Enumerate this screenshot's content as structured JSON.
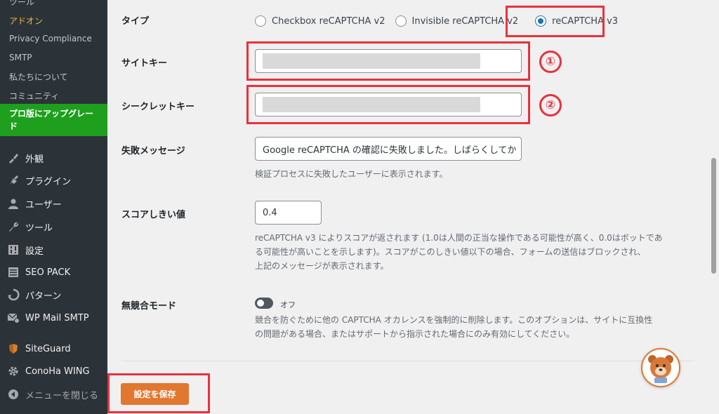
{
  "sidebar": {
    "submenu": [
      {
        "label": "ツール",
        "active": false
      },
      {
        "label": "アドオン",
        "active": true
      },
      {
        "label": "Privacy Compliance",
        "active": false
      },
      {
        "label": "SMTP",
        "active": false
      },
      {
        "label": "私たちについて",
        "active": false
      },
      {
        "label": "コミュニティ",
        "active": false
      }
    ],
    "upgrade_label": "プロ版にアップグレード",
    "menu": [
      {
        "label": "外観",
        "icon": "paintbrush-icon"
      },
      {
        "label": "プラグイン",
        "icon": "plugin-icon"
      },
      {
        "label": "ユーザー",
        "icon": "user-icon"
      },
      {
        "label": "ツール",
        "icon": "wrench-icon"
      },
      {
        "label": "設定",
        "icon": "settings-icon"
      },
      {
        "label": "SEO PACK",
        "icon": "list-icon"
      },
      {
        "label": "パターン",
        "icon": "patterns-icon"
      },
      {
        "label": "WP Mail SMTP",
        "icon": "mail-icon"
      },
      {
        "label": "SiteGuard",
        "icon": "shield-icon"
      },
      {
        "label": "ConoHa WING",
        "icon": "gear-icon"
      },
      {
        "label": "メニューを閉じる",
        "icon": "collapse-icon"
      }
    ]
  },
  "form": {
    "type_label": "タイプ",
    "type_options": [
      "Checkbox reCAPTCHA v2",
      "Invisible reCAPTCHA v2",
      "reCAPTCHA v3"
    ],
    "type_selected": "reCAPTCHA v3",
    "site_key_label": "サイトキー",
    "site_key_value": "",
    "secret_key_label": "シークレットキー",
    "secret_key_value": "",
    "fail_message_label": "失敗メッセージ",
    "fail_message_value": "Google reCAPTCHA の確認に失敗しました。しばらくしてか",
    "fail_message_desc": "検証プロセスに失敗したユーザーに表示されます。",
    "score_label": "スコアしきい値",
    "score_value": "0.4",
    "score_desc_1": "reCAPTCHA v3 によりスコアが返されます (1.0は人間の正当な操作である可能性が高く、0.0はボットであ",
    "score_desc_2": "る可能性が高いことを示します)。スコアがこのしきい値以下の場合、フォームの送信はブロックされ、",
    "score_desc_3": "上記のメッセージが表示されます。",
    "no_conflict_label": "無競合モード",
    "no_conflict_state": "オフ",
    "no_conflict_desc_1": "競合を防ぐために他の CAPTCHA オカレンスを強制的に削除します。このオプションは、サイトに互換性",
    "no_conflict_desc_2": "の問題がある場合、またはサポートから指示された場合にのみ有効にしてください。",
    "save_label": "設定を保存"
  },
  "annotations": {
    "one": "①",
    "two": "②"
  },
  "colors": {
    "accent_orange": "#e27730",
    "annotation_red": "#e8323b",
    "upgrade_green": "#1ea01e",
    "radio_blue": "#2271b1"
  }
}
